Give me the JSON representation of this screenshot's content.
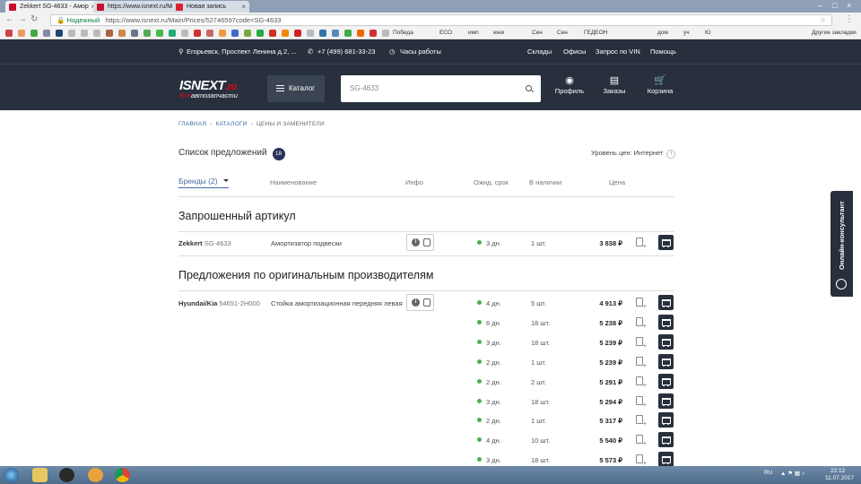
{
  "browser": {
    "tabs": [
      {
        "label": "Zekkert SG-4633 - Амор",
        "active": true
      },
      {
        "label": "https://www.isnext.ru/M",
        "active": false
      },
      {
        "label": "Новая запись",
        "active": false
      }
    ],
    "secure_label": "Надежный",
    "url": "https://www.isnext.ru/Main/Prices/52746597code=SG-4633",
    "bookmarks": [
      "Победа",
      "ECO",
      "имп",
      "юни",
      "Сен",
      "Сен",
      "ГЕДЕОН",
      "дом",
      "уч",
      "Ю"
    ],
    "other_bookmarks": "Другие закладки"
  },
  "site": {
    "topbar": {
      "address": "Егорьевск, Проспект Ленина д.2, ...",
      "phone": "+7 (499) 681-33-23",
      "hours": "Часы работы",
      "links": [
        "Склады",
        "Офисы",
        "Запрос по VIN",
        "Помощь"
      ]
    },
    "logo": {
      "main": "ISNEXT",
      "ru": ".ru",
      "vse": "Все",
      "tagline": "автозапчасти"
    },
    "catalog_label": "Каталог",
    "search_value": "SG-4633",
    "header_icons": [
      {
        "name": "profile",
        "label": "Профиль",
        "glyph": "◉"
      },
      {
        "name": "orders",
        "label": "Заказы",
        "glyph": "▤"
      },
      {
        "name": "cart",
        "label": "Корзина",
        "glyph": "🛒"
      }
    ]
  },
  "breadcrumbs": [
    "ГЛАВНАЯ",
    "КАТАЛОГИ",
    "ЦЕНЫ И ЗАМЕНИТЕЛИ"
  ],
  "offers": {
    "title": "Список предложений",
    "count": "18",
    "price_level": "Уровень цен: Интернет",
    "price_level_help": "!"
  },
  "columns": {
    "brands": "Бренды (2)",
    "name": "Наименование",
    "info": "Инфо",
    "wait": "Ожид. срок",
    "stock": "В наличии",
    "price": "Цена"
  },
  "requested": {
    "title": "Запрошенный артикул",
    "row": {
      "brand": "Zekkert",
      "article": "SG-4633",
      "name": "Амортизатор подвески",
      "days": "3 дн.",
      "stock": "1 шт.",
      "price": "3 838 ₽"
    }
  },
  "original": {
    "title": "Предложения по оригинальным производителям",
    "brand": "Hyundai/Kia",
    "article": "54651-2H000",
    "name": "Стойка амортизационная передняя левая",
    "offers": [
      {
        "days": "4 дн.",
        "stock": "5 шт.",
        "price": "4 913 ₽"
      },
      {
        "days": "6 дн.",
        "stock": "18 шт.",
        "price": "5 238 ₽"
      },
      {
        "days": "3 дн.",
        "stock": "18 шт.",
        "price": "5 239 ₽"
      },
      {
        "days": "2 дн.",
        "stock": "1 шт.",
        "price": "5 239 ₽"
      },
      {
        "days": "2 дн.",
        "stock": "2 шт.",
        "price": "5 291 ₽"
      },
      {
        "days": "3 дн.",
        "stock": "18 шт.",
        "price": "5 294 ₽"
      },
      {
        "days": "2 дн.",
        "stock": "1 шт.",
        "price": "5 317 ₽"
      },
      {
        "days": "4 дн.",
        "stock": "10 шт.",
        "price": "5 540 ₽"
      },
      {
        "days": "3 дн.",
        "stock": "18 шт.",
        "price": "5 573 ₽"
      }
    ]
  },
  "consultant": "Онлайн-консультант",
  "taskbar": {
    "lang": "RU",
    "time": "22:12",
    "date": "11.07.2017"
  }
}
